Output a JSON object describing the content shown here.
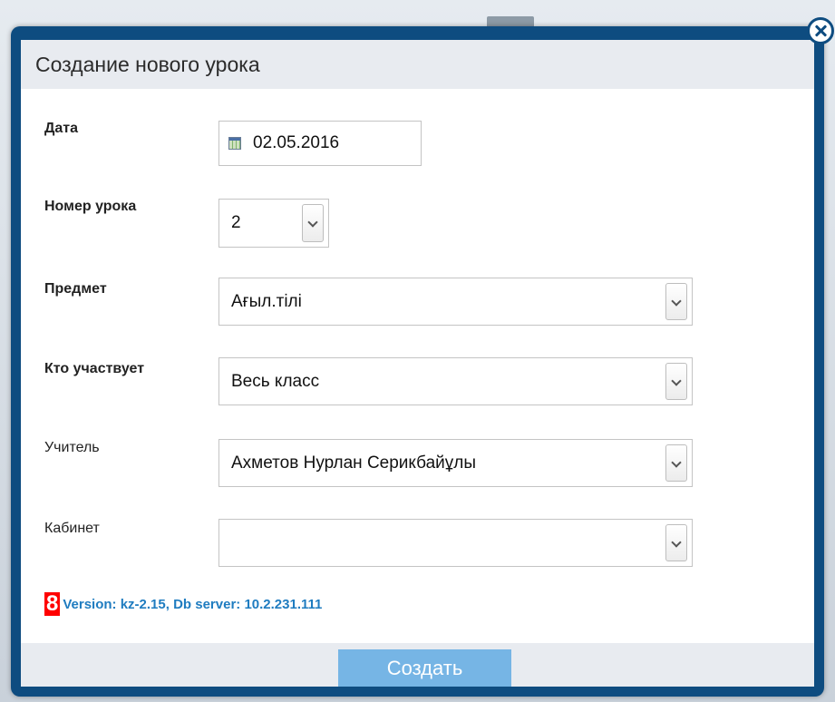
{
  "dialog": {
    "title": "Создание нового урока"
  },
  "form": {
    "date": {
      "label": "Дата",
      "value": "02.05.2016"
    },
    "lesson_number": {
      "label": "Номер урока",
      "value": "2"
    },
    "subject": {
      "label": "Предмет",
      "value": "Ағыл.тілі"
    },
    "participants": {
      "label": "Кто участвует",
      "value": "Весь класс"
    },
    "teacher": {
      "label": "Учитель",
      "value": "Ахметов Нурлан Серикбайұлы"
    },
    "room": {
      "label": "Кабинет",
      "value": ""
    }
  },
  "version": {
    "badge": "8",
    "text": "Version: kz-2.15, Db server: 10.2.231.111"
  },
  "footer": {
    "create_label": "Создать"
  },
  "colors": {
    "frame": "#0e4c80",
    "title_bar": "#e8ebf0",
    "button": "#76b5e5",
    "badge": "#ff0000",
    "version_text": "#1f7cc0"
  },
  "icons": {
    "close": "close-icon",
    "calendar": "calendar-icon",
    "dropdown": "chevron-down-icon"
  }
}
